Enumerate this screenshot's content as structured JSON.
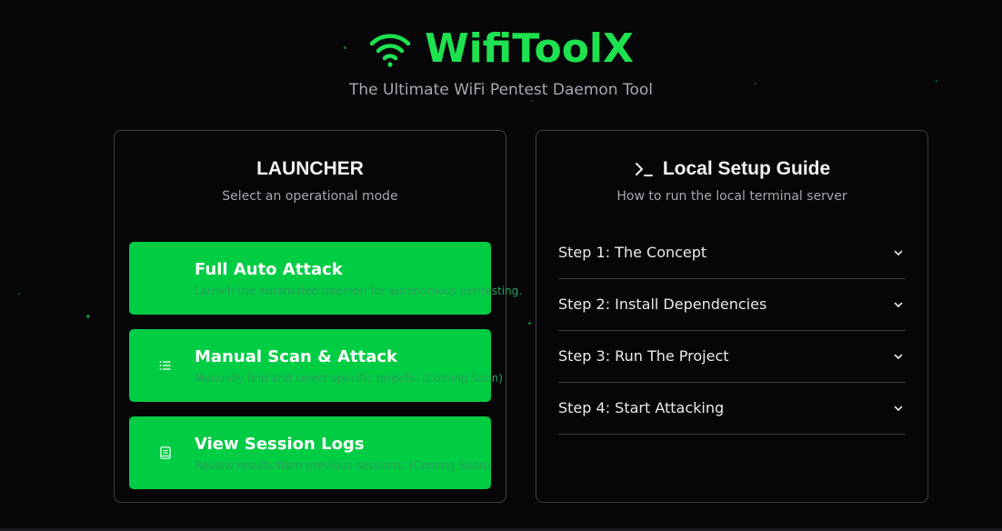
{
  "app": {
    "title": "WifiToolX",
    "subtitle": "The Ultimate WiFi Pentest Daemon Tool",
    "accent_color": "#1ee24f",
    "button_color": "#00cc44"
  },
  "launcher": {
    "title": "LAUNCHER",
    "subtitle": "Select an operational mode",
    "modes": [
      {
        "icon": "none",
        "title": "Full Auto Attack",
        "description": "Launch the automated daemon for autonomous pentesting."
      },
      {
        "icon": "list-icon",
        "title": "Manual Scan & Attack",
        "description": "Manually find and select specific targets. (Coming Soon)"
      },
      {
        "icon": "book-icon",
        "title": "View Session Logs",
        "description": "Review results from previous sessions. (Coming Soon)"
      }
    ]
  },
  "guide": {
    "icon": "terminal-icon",
    "title": "Local Setup Guide",
    "subtitle": "How to run the local terminal server",
    "steps": [
      {
        "label": "Step 1: The Concept"
      },
      {
        "label": "Step 2: Install Dependencies"
      },
      {
        "label": "Step 3: Run The Project"
      },
      {
        "label": "Step 4: Start Attacking"
      }
    ]
  }
}
